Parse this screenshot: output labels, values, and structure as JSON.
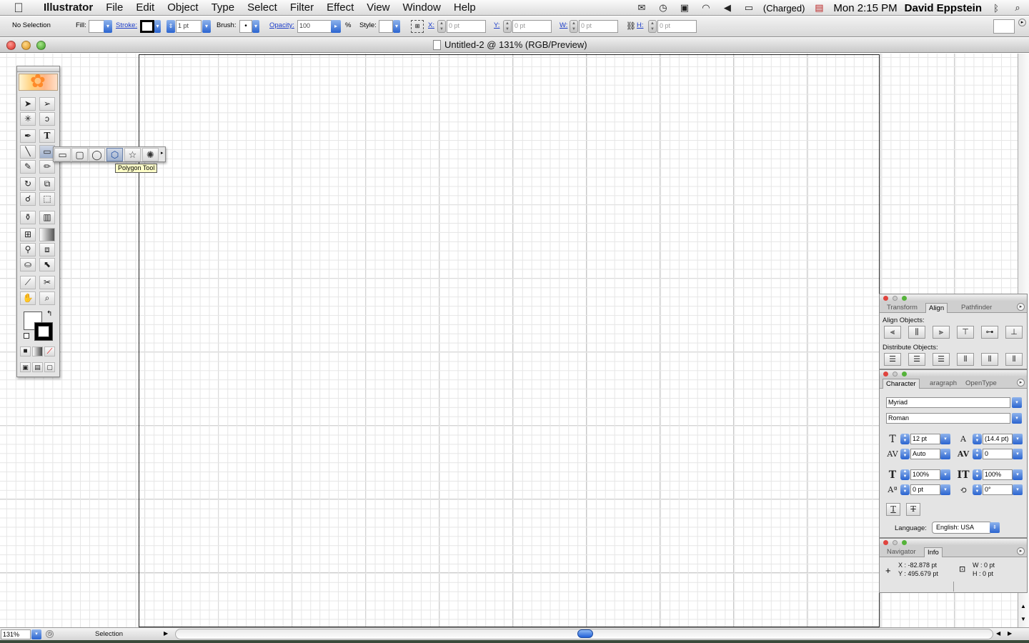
{
  "menubar": {
    "app": "Illustrator",
    "items": [
      "File",
      "Edit",
      "Object",
      "Type",
      "Select",
      "Filter",
      "Effect",
      "View",
      "Window",
      "Help"
    ],
    "battery": "(Charged)",
    "clock": "Mon 2:15 PM",
    "user": "David Eppstein"
  },
  "control": {
    "selection": "No Selection",
    "fill_label": "Fill:",
    "stroke_label": "Stroke:",
    "stroke_weight": "1 pt",
    "brush_label": "Brush:",
    "opacity_label": "Opacity:",
    "opacity_value": "100",
    "percent": "%",
    "style_label": "Style:",
    "x_label": "X:",
    "x_value": "0 pt",
    "y_label": "Y:",
    "y_value": "0 pt",
    "w_label": "W:",
    "w_value": "0 pt",
    "h_label": "H:",
    "h_value": "0 pt"
  },
  "document": {
    "title": "Untitled-2 @ 131% (RGB/Preview)"
  },
  "flyout": {
    "tooltip": "Polygon Tool"
  },
  "status": {
    "zoom": "131%",
    "mode": "Selection"
  },
  "align_panel": {
    "tabs": [
      "Transform",
      "Align",
      "Pathfinder"
    ],
    "align_label": "Align Objects:",
    "distribute_label": "Distribute Objects:"
  },
  "char_panel": {
    "tabs": [
      "Character",
      "aragraph",
      "OpenType"
    ],
    "font": "Myriad",
    "style": "Roman",
    "size": "12 pt",
    "leading": "(14.4 pt)",
    "kerning": "Auto",
    "tracking": "0",
    "vscale": "100%",
    "hscale": "100%",
    "baseline": "0 pt",
    "rotation": "0°",
    "language_label": "Language:",
    "language": "English: USA"
  },
  "info_panel": {
    "tabs": [
      "Navigator",
      "Info"
    ],
    "x": "X : -82.878 pt",
    "y": "Y : 495.679 pt",
    "w": "W : 0 pt",
    "h": "H : 0 pt"
  },
  "colors": {
    "accent": "#2a64d0",
    "close": "#e0443e",
    "minimize": "#e5a321",
    "zoom": "#55b33a"
  }
}
